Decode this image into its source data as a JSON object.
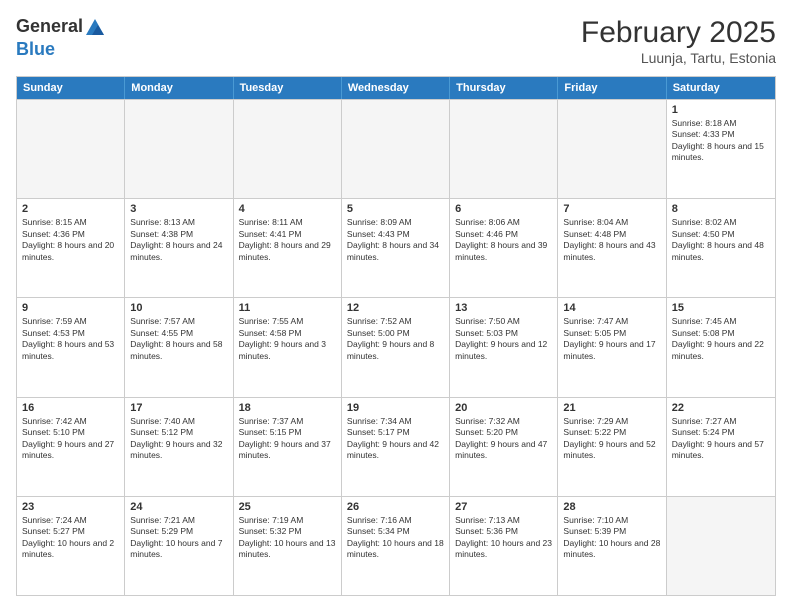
{
  "header": {
    "logo_general": "General",
    "logo_blue": "Blue",
    "month_year": "February 2025",
    "location": "Luunja, Tartu, Estonia"
  },
  "days": [
    "Sunday",
    "Monday",
    "Tuesday",
    "Wednesday",
    "Thursday",
    "Friday",
    "Saturday"
  ],
  "weeks": [
    [
      {
        "day": "",
        "text": ""
      },
      {
        "day": "",
        "text": ""
      },
      {
        "day": "",
        "text": ""
      },
      {
        "day": "",
        "text": ""
      },
      {
        "day": "",
        "text": ""
      },
      {
        "day": "",
        "text": ""
      },
      {
        "day": "1",
        "text": "Sunrise: 8:18 AM\nSunset: 4:33 PM\nDaylight: 8 hours and 15 minutes."
      }
    ],
    [
      {
        "day": "2",
        "text": "Sunrise: 8:15 AM\nSunset: 4:36 PM\nDaylight: 8 hours and 20 minutes."
      },
      {
        "day": "3",
        "text": "Sunrise: 8:13 AM\nSunset: 4:38 PM\nDaylight: 8 hours and 24 minutes."
      },
      {
        "day": "4",
        "text": "Sunrise: 8:11 AM\nSunset: 4:41 PM\nDaylight: 8 hours and 29 minutes."
      },
      {
        "day": "5",
        "text": "Sunrise: 8:09 AM\nSunset: 4:43 PM\nDaylight: 8 hours and 34 minutes."
      },
      {
        "day": "6",
        "text": "Sunrise: 8:06 AM\nSunset: 4:46 PM\nDaylight: 8 hours and 39 minutes."
      },
      {
        "day": "7",
        "text": "Sunrise: 8:04 AM\nSunset: 4:48 PM\nDaylight: 8 hours and 43 minutes."
      },
      {
        "day": "8",
        "text": "Sunrise: 8:02 AM\nSunset: 4:50 PM\nDaylight: 8 hours and 48 minutes."
      }
    ],
    [
      {
        "day": "9",
        "text": "Sunrise: 7:59 AM\nSunset: 4:53 PM\nDaylight: 8 hours and 53 minutes."
      },
      {
        "day": "10",
        "text": "Sunrise: 7:57 AM\nSunset: 4:55 PM\nDaylight: 8 hours and 58 minutes."
      },
      {
        "day": "11",
        "text": "Sunrise: 7:55 AM\nSunset: 4:58 PM\nDaylight: 9 hours and 3 minutes."
      },
      {
        "day": "12",
        "text": "Sunrise: 7:52 AM\nSunset: 5:00 PM\nDaylight: 9 hours and 8 minutes."
      },
      {
        "day": "13",
        "text": "Sunrise: 7:50 AM\nSunset: 5:03 PM\nDaylight: 9 hours and 12 minutes."
      },
      {
        "day": "14",
        "text": "Sunrise: 7:47 AM\nSunset: 5:05 PM\nDaylight: 9 hours and 17 minutes."
      },
      {
        "day": "15",
        "text": "Sunrise: 7:45 AM\nSunset: 5:08 PM\nDaylight: 9 hours and 22 minutes."
      }
    ],
    [
      {
        "day": "16",
        "text": "Sunrise: 7:42 AM\nSunset: 5:10 PM\nDaylight: 9 hours and 27 minutes."
      },
      {
        "day": "17",
        "text": "Sunrise: 7:40 AM\nSunset: 5:12 PM\nDaylight: 9 hours and 32 minutes."
      },
      {
        "day": "18",
        "text": "Sunrise: 7:37 AM\nSunset: 5:15 PM\nDaylight: 9 hours and 37 minutes."
      },
      {
        "day": "19",
        "text": "Sunrise: 7:34 AM\nSunset: 5:17 PM\nDaylight: 9 hours and 42 minutes."
      },
      {
        "day": "20",
        "text": "Sunrise: 7:32 AM\nSunset: 5:20 PM\nDaylight: 9 hours and 47 minutes."
      },
      {
        "day": "21",
        "text": "Sunrise: 7:29 AM\nSunset: 5:22 PM\nDaylight: 9 hours and 52 minutes."
      },
      {
        "day": "22",
        "text": "Sunrise: 7:27 AM\nSunset: 5:24 PM\nDaylight: 9 hours and 57 minutes."
      }
    ],
    [
      {
        "day": "23",
        "text": "Sunrise: 7:24 AM\nSunset: 5:27 PM\nDaylight: 10 hours and 2 minutes."
      },
      {
        "day": "24",
        "text": "Sunrise: 7:21 AM\nSunset: 5:29 PM\nDaylight: 10 hours and 7 minutes."
      },
      {
        "day": "25",
        "text": "Sunrise: 7:19 AM\nSunset: 5:32 PM\nDaylight: 10 hours and 13 minutes."
      },
      {
        "day": "26",
        "text": "Sunrise: 7:16 AM\nSunset: 5:34 PM\nDaylight: 10 hours and 18 minutes."
      },
      {
        "day": "27",
        "text": "Sunrise: 7:13 AM\nSunset: 5:36 PM\nDaylight: 10 hours and 23 minutes."
      },
      {
        "day": "28",
        "text": "Sunrise: 7:10 AM\nSunset: 5:39 PM\nDaylight: 10 hours and 28 minutes."
      },
      {
        "day": "",
        "text": ""
      }
    ]
  ]
}
